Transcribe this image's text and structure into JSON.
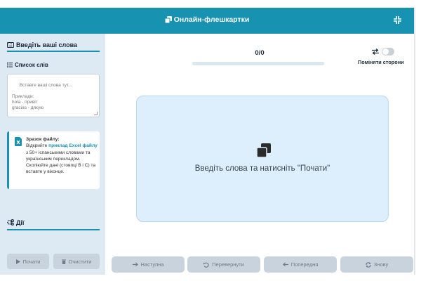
{
  "header": {
    "title": "Онлайн-флешкартки",
    "icon": "clone-icon",
    "fullscreen_icon": "compress-icon"
  },
  "sidebar": {
    "words_section": {
      "title": "Введіть ваші слова",
      "icon": "keyboard-icon"
    },
    "word_list": {
      "title": "Список слів",
      "icon": "list-icon",
      "placeholder": "Вставте ваші слова тут...\n\nПриклади:\nhola - привіт\ngracias - дякую"
    },
    "sample": {
      "title": "Зразок файлу:",
      "text_before": "Відкрийте",
      "link": "приклад Excel файлу",
      "text_after": "з 50+ іспанськими словами та українським перекладом. Скопіюйте дані (стовпці B і C) та вставте у віконце.",
      "icon": "file-excel-icon"
    },
    "actions": {
      "title": "Дії",
      "icon": "cogs-icon"
    },
    "buttons": {
      "start": "Почати",
      "clear": "Очистити"
    }
  },
  "main": {
    "counter": "0/0",
    "progress": 0,
    "swap_label": "Поміняти сторони",
    "swap_on": false,
    "card_text": "Введіть слова та натисніть \"Почати\"",
    "card_icon": "clone-icon",
    "nav": {
      "next": "Наступна",
      "flip": "Перевернути",
      "prev": "Попередня",
      "again": "Знову"
    }
  },
  "colors": {
    "accent": "#1792b0",
    "sidebar_bg": "#dde9f3",
    "card_bg": "#ddeefc",
    "button_disabled": "#c8d3dd"
  }
}
